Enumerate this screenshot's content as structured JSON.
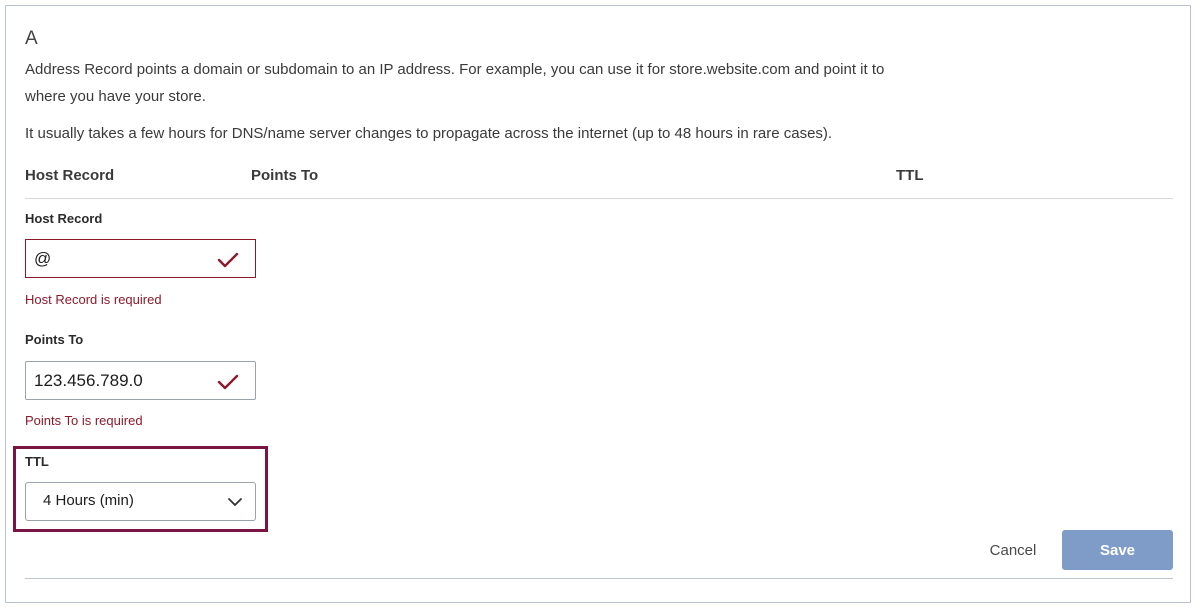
{
  "record": {
    "type_title": "A",
    "description": "Address Record points a domain or subdomain to an IP address. For example, you can use it for store.website.com and point it to where you have your store.",
    "propagation_note": "It usually takes a few hours for DNS/name server changes to propagate across the internet (up to 48 hours in rare cases)."
  },
  "table_headers": {
    "host_record": "Host Record",
    "points_to": "Points To",
    "ttl": "TTL"
  },
  "form": {
    "host_record": {
      "label": "Host Record",
      "value": "@",
      "error": "Host Record is required"
    },
    "points_to": {
      "label": "Points To",
      "value": "123.456.789.0",
      "error": "Points To is required"
    },
    "ttl": {
      "label": "TTL",
      "selected": "4 Hours (min)"
    }
  },
  "actions": {
    "cancel_label": "Cancel",
    "save_label": "Save"
  },
  "colors": {
    "error": "#8b1a2b",
    "highlight": "#7a1442",
    "save_button": "#7f9cc9"
  },
  "icons": {
    "valid": "checkmark-icon",
    "dropdown": "chevron-down-icon"
  }
}
